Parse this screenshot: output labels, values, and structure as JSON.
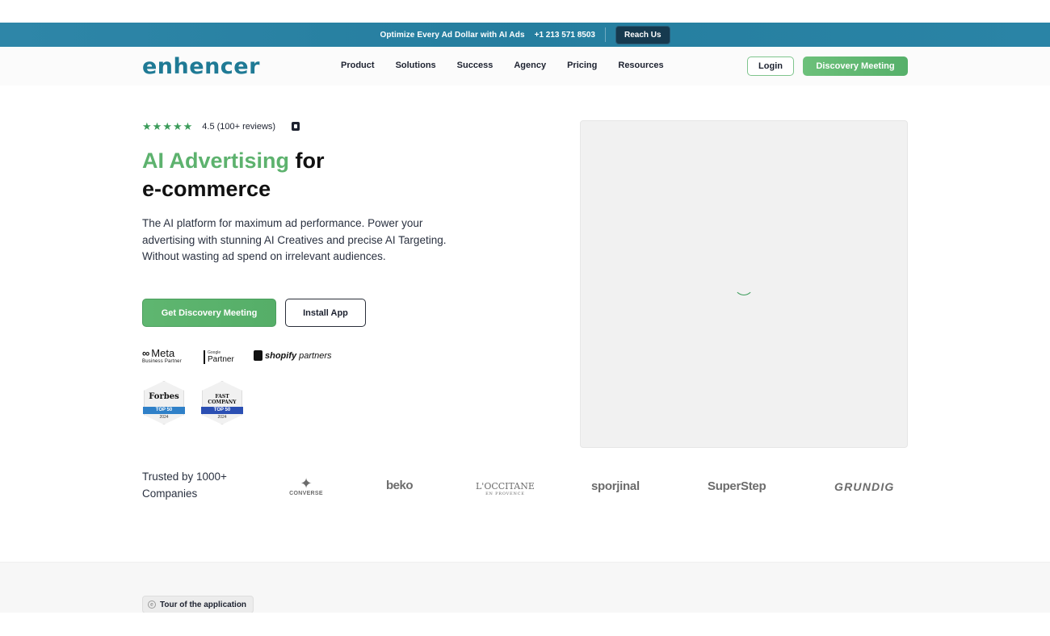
{
  "announcement": {
    "text": "Optimize Every Ad Dollar with AI Ads",
    "phone": "+1 213 571 8503",
    "cta": "Reach Us"
  },
  "header": {
    "logo": "enhencer",
    "nav": [
      "Product",
      "Solutions",
      "Success",
      "Agency",
      "Pricing",
      "Resources"
    ],
    "login": "Login",
    "discovery": "Discovery Meeting"
  },
  "hero": {
    "rating_text": "4.5 (100+ reviews)",
    "rating_value": 4.5,
    "title_highlight": "AI Advertising",
    "title_rest_1": "for",
    "title_rest_2": "e-commerce",
    "subtitle": "The AI platform for maximum ad performance. Power your advertising with stunning AI Creatives and precise AI Targeting. Without wasting ad spend on irrelevant audiences.",
    "cta_primary": "Get Discovery Meeting",
    "cta_secondary": "Install App",
    "partners": {
      "meta_name": "Meta",
      "meta_sub": "Business Partner",
      "google_top": "Google",
      "google_name": "Partner",
      "shopify_name": "shopify",
      "shopify_sub": "partners"
    },
    "badges": [
      {
        "brand": "Forbes",
        "ribbon": "TOP 50",
        "year": "2024"
      },
      {
        "brand": "FAST COMPANY",
        "ribbon": "TOP 50",
        "year": "2024"
      }
    ]
  },
  "trusted": {
    "label": "Trusted by 1000+ Companies",
    "brands": [
      "CONVERSE",
      "beko",
      "L'OCCITANE",
      "EN PROVENCE",
      "sporjinal",
      "SuperStep",
      "GRUNDIG"
    ]
  },
  "tour": {
    "label": "Tour of the application"
  },
  "colors": {
    "accent_green": "#5db26e",
    "brand_blue": "#1f7a95",
    "announce_bg": "#2a82a4"
  }
}
